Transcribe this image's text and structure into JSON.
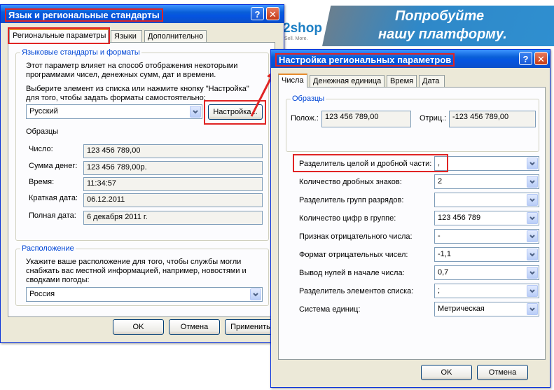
{
  "ad": {
    "brand": "2shop",
    "brand_sub": "Sell. More.",
    "line1": "Попробуйте",
    "line2": "нашу платформу."
  },
  "window1": {
    "title": "Язык и региональные стандарты",
    "help_icon": "question-icon",
    "close_icon": "close-icon",
    "tabs": [
      "Региональные параметры",
      "Языки",
      "Дополнительно"
    ],
    "group1": {
      "label": "Языковые стандарты и форматы",
      "desc1": "Этот параметр влияет на способ отображения некоторыми",
      "desc2": "программами чисел, денежных сумм, дат и времени.",
      "instr1": "Выберите элемент из списка или нажмите кнопку \"Настройка\"",
      "instr2": "для того, чтобы задать форматы самостоятельно:",
      "locale": "Русский",
      "customize": "Настройка...",
      "samples_label": "Образцы",
      "samples": [
        {
          "label": "Число:",
          "value": "123 456 789,00"
        },
        {
          "label": "Сумма денег:",
          "value": "123 456 789,00р."
        },
        {
          "label": "Время:",
          "value": "11:34:57"
        },
        {
          "label": "Краткая дата:",
          "value": "06.12.2011"
        },
        {
          "label": "Полная дата:",
          "value": "6 декабря 2011 г."
        }
      ]
    },
    "group2": {
      "label": "Расположение",
      "desc1": "Укажите ваше расположение для того, чтобы службы могли",
      "desc2": "снабжать вас местной информацией, например, новостями и",
      "desc3": "сводками погоды:",
      "location": "Россия"
    },
    "buttons": {
      "ok": "OK",
      "cancel": "Отмена",
      "apply": "Применить"
    }
  },
  "window2": {
    "title": "Настройка региональных параметров",
    "help_icon": "question-icon",
    "close_icon": "close-icon",
    "tabs": [
      "Числа",
      "Денежная единица",
      "Время",
      "Дата"
    ],
    "samples": {
      "label": "Образцы",
      "positive_label": "Полож.:",
      "positive_value": "123 456 789,00",
      "negative_label": "Отриц.:",
      "negative_value": "-123 456 789,00"
    },
    "settings": [
      {
        "label": "Разделитель целой и дробной части:",
        "value": ","
      },
      {
        "label": "Количество дробных знаков:",
        "value": "2"
      },
      {
        "label": "Разделитель групп разрядов:",
        "value": ""
      },
      {
        "label": "Количество цифр в группе:",
        "value": "123 456 789"
      },
      {
        "label": "Признак отрицательного числа:",
        "value": "-"
      },
      {
        "label": "Формат отрицательных чисел:",
        "value": "-1,1"
      },
      {
        "label": "Вывод нулей в начале числа:",
        "value": "0,7"
      },
      {
        "label": "Разделитель элементов списка:",
        "value": ";"
      },
      {
        "label": "Система единиц:",
        "value": "Метрическая"
      }
    ],
    "buttons": {
      "ok": "OK",
      "cancel": "Отмена"
    }
  },
  "colors": {
    "accent_red": "#e02424",
    "xp_blue": "#0a5fd8",
    "dialog_bg": "#ece9d8"
  }
}
